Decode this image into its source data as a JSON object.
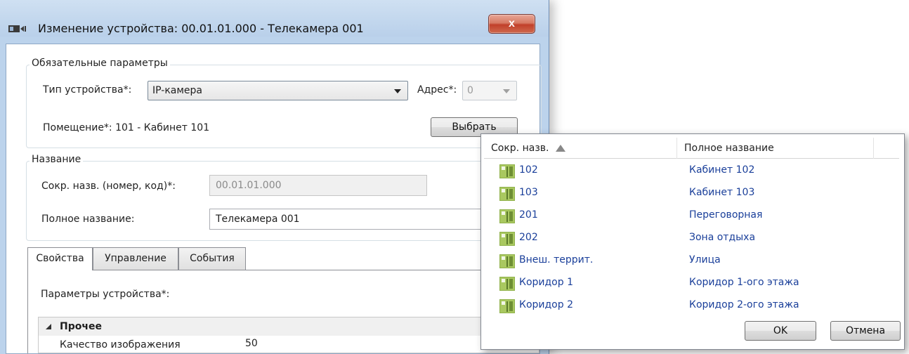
{
  "window": {
    "title": "Изменение устройства: 00.01.01.000 - Телекамера 001",
    "close_glyph": "x"
  },
  "required": {
    "title": "Обязательные параметры",
    "device_type_label": "Тип устройства*:",
    "device_type_value": "IP-камера",
    "address_label": "Адрес*:",
    "address_value": "0",
    "room_label": "Помещение*: 101 - Кабинет 101",
    "choose_button": "Выбрать"
  },
  "name": {
    "title": "Название",
    "short_label": "Сокр. назв. (номер, код)*:",
    "short_value": "00.01.01.000",
    "full_label": "Полное название:",
    "full_value": "Телекамера 001"
  },
  "tabs": [
    "Свойства",
    "Управление",
    "События"
  ],
  "properties": {
    "params_label": "Параметры устройства*:",
    "category": "Прочее",
    "quality_label": "Качество изображения",
    "quality_value": "50"
  },
  "popup": {
    "columns": [
      "Сокр. назв.",
      "Полное название"
    ],
    "rows": [
      {
        "short": "102",
        "full": "Кабинет 102"
      },
      {
        "short": "103",
        "full": "Кабинет 103"
      },
      {
        "short": "201",
        "full": "Переговорная"
      },
      {
        "short": "202",
        "full": "Зона отдыха"
      },
      {
        "short": "Внеш. террит.",
        "full": "Улица"
      },
      {
        "short": "Коридор 1",
        "full": "Коридор 1-ого этажа"
      },
      {
        "short": "Коридор 2",
        "full": "Коридор 2-ого этажа"
      }
    ],
    "ok": "OK",
    "cancel": "Отмена"
  },
  "colors": {
    "title_bar": "#bcd3ec",
    "link_text": "#1a3f9a",
    "close_button": "#c1402a",
    "room_icon": "#8fb14a"
  },
  "icons": {
    "app": "camera-icon",
    "room": "room-icon",
    "sort": "sort-ascending-icon"
  }
}
